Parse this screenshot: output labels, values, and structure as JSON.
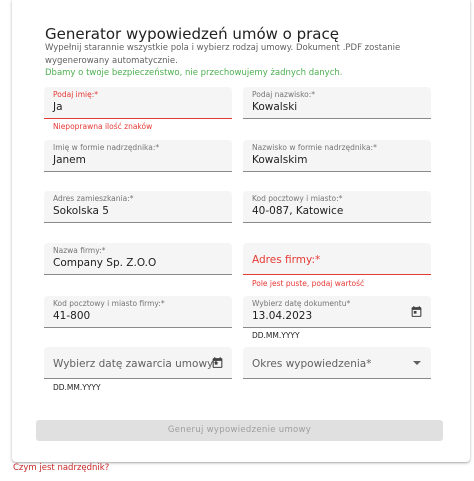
{
  "header": {
    "title": "Generator wypowiedzeń umów o pracę",
    "description": "Wypełnij starannie wszystkie pola i wybierz rodzaj umowy. Dokument .PDF zostanie wygenerowany automatycznie.",
    "security_note": "Dbamy o twoje bezpieczeństwo, nie przechowujemy żadnych danych."
  },
  "colors": {
    "error": "#e53935",
    "success": "#4caf50",
    "link": "#c62828"
  },
  "fields": {
    "first_name": {
      "label": "Podaj imię:*",
      "value": "Ja",
      "error": "Niepoprawna ilość znaków"
    },
    "last_name": {
      "label": "Podaj nazwisko:*",
      "value": "Kowalski"
    },
    "first_name_genitive": {
      "label": "Imię w formie nadrzędnika:*",
      "value": "Janem"
    },
    "last_name_genitive": {
      "label": "Nazwisko w formie nadrzędnika:*",
      "value": "Kowalskim"
    },
    "address": {
      "label": "Adres zamieszkania:*",
      "value": "Sokolska 5"
    },
    "postal_city": {
      "label": "Kod pocztowy i miasto:*",
      "value": "40-087, Katowice"
    },
    "company_name": {
      "label": "Nazwa firmy:*",
      "value": "Company Sp. Z.O.O"
    },
    "company_address": {
      "placeholder": "Adres firmy:*",
      "error": "Pole jest puste, podaj wartość"
    },
    "company_postal_city": {
      "label": "Kod pocztowy i miasto firmy:*",
      "value": "41-800"
    },
    "document_date": {
      "label": "Wybierz datę dokumentu*",
      "value": "13.04.2023",
      "hint": "DD.MM.YYYY",
      "icon": "calendar-icon"
    },
    "contract_date": {
      "placeholder": "Wybierz datę zawarcia umowy*",
      "hint": "DD.MM.YYYY",
      "icon": "calendar-icon"
    },
    "notice_period": {
      "placeholder": "Okres wypowiedzenia*",
      "icon": "chevron-down-icon"
    }
  },
  "submit_label": "Generuj wypowiedzenie umowy",
  "help_link": "Czym jest nadrzędnik?"
}
